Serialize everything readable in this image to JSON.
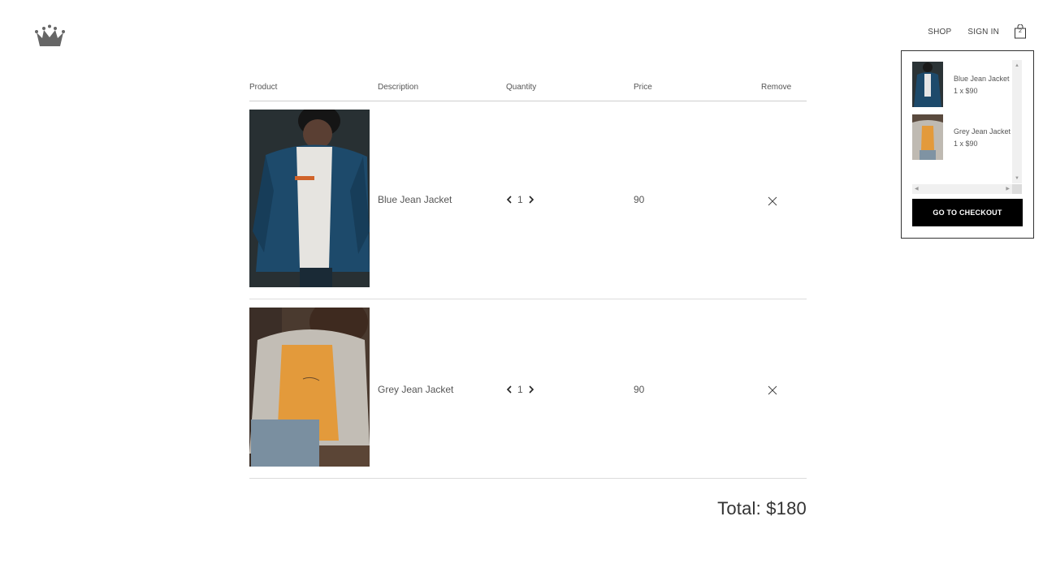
{
  "nav": {
    "shop": "SHOP",
    "sign_in": "SIGN IN",
    "bag_count": "2"
  },
  "mini_cart": {
    "items": [
      {
        "name": "Blue Jean Jacket",
        "qty_price": "1 x $90"
      },
      {
        "name": "Grey Jean Jacket",
        "qty_price": "1 x $90"
      }
    ],
    "checkout_label": "GO TO CHECKOUT"
  },
  "cart": {
    "headers": {
      "product": "Product",
      "description": "Description",
      "quantity": "Quantity",
      "price": "Price",
      "remove": "Remove"
    },
    "rows": [
      {
        "description": "Blue Jean Jacket",
        "quantity": "1",
        "price": "90"
      },
      {
        "description": "Grey Jean Jacket",
        "quantity": "1",
        "price": "90"
      }
    ],
    "total": "Total: $180"
  },
  "colors": {
    "checkout_bg": "#000000",
    "divider": "#dcdcdc",
    "denim": "#1d4a6b",
    "mustard": "#e39a3b"
  }
}
